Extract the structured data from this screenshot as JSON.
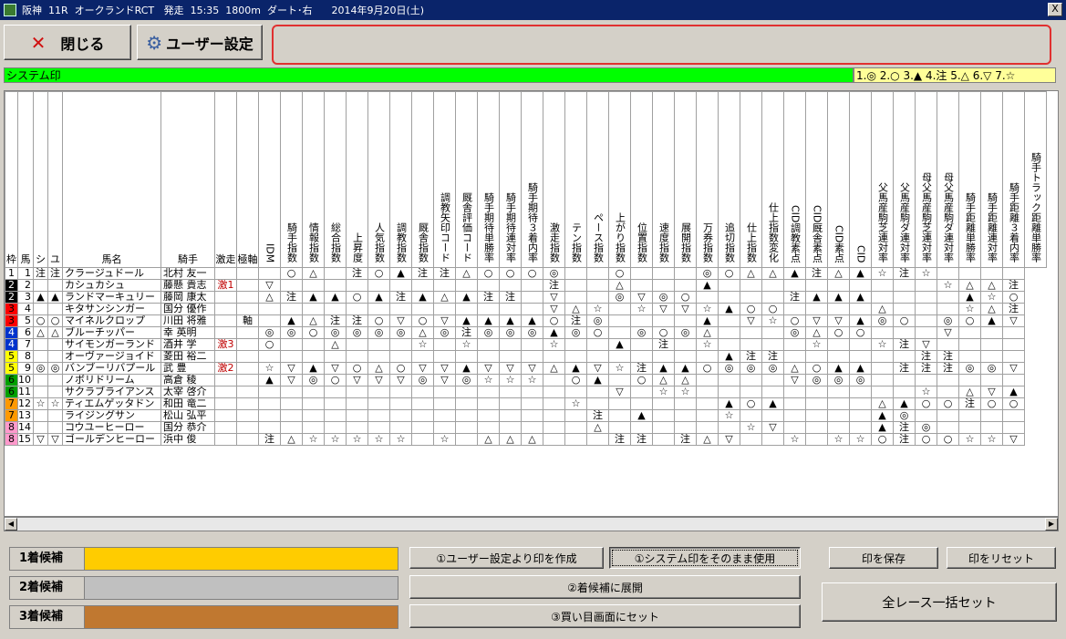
{
  "window": {
    "title": "阪神  11R  オークランドRCT   発走  15:35  1800m  ダート･右      2014年9月20日(土)",
    "close_glyph": "X"
  },
  "toolbar": {
    "close_label": "閉じる",
    "user_settings_label": "ユーザー設定"
  },
  "system_mark_bar": "システム印",
  "mark_legend": "1.◎ 2.○ 3.▲ 4.注 5.△ 6.▽ 7.☆",
  "columns": [
    {
      "label": "枠",
      "v": false
    },
    {
      "label": "馬",
      "v": false
    },
    {
      "label": "シ",
      "v": false
    },
    {
      "label": "ユ",
      "v": false
    },
    {
      "label": "馬名",
      "v": false
    },
    {
      "label": "騎手",
      "v": false
    },
    {
      "label": "激走",
      "v": false
    },
    {
      "label": "極軸",
      "v": false
    },
    {
      "label": "IDM",
      "v": true
    },
    {
      "label": "騎手指数",
      "v": true
    },
    {
      "label": "情報指数",
      "v": true
    },
    {
      "label": "総合指数",
      "v": true
    },
    {
      "label": "上昇度",
      "v": true
    },
    {
      "label": "人気指数",
      "v": true
    },
    {
      "label": "調教指数",
      "v": true
    },
    {
      "label": "厩舎指数",
      "v": true
    },
    {
      "label": "調教矢印コード",
      "v": true
    },
    {
      "label": "厩舎評価コード",
      "v": true
    },
    {
      "label": "騎手期待単勝率",
      "v": true
    },
    {
      "label": "騎手期待連対率",
      "v": true
    },
    {
      "label": "騎手期待３着内率",
      "v": true
    },
    {
      "label": "激走指数",
      "v": true
    },
    {
      "label": "テン指数",
      "v": true
    },
    {
      "label": "ペース指数",
      "v": true
    },
    {
      "label": "上がり指数",
      "v": true
    },
    {
      "label": "位置指数",
      "v": true
    },
    {
      "label": "速度指数",
      "v": true
    },
    {
      "label": "展開指数",
      "v": true
    },
    {
      "label": "万券指数",
      "v": true
    },
    {
      "label": "追切指数",
      "v": true
    },
    {
      "label": "仕上指数",
      "v": true
    },
    {
      "label": "仕上指数変化",
      "v": true
    },
    {
      "label": "CID調教素点",
      "v": true
    },
    {
      "label": "CID厩舎素点",
      "v": true
    },
    {
      "label": "CID素点",
      "v": true
    },
    {
      "label": "CID",
      "v": true
    },
    {
      "label": "父馬産駒芝連対率",
      "v": true
    },
    {
      "label": "父馬産駒ダ連対率",
      "v": true
    },
    {
      "label": "母父馬産駒芝連対率",
      "v": true
    },
    {
      "label": "母父馬産駒ダ連対率",
      "v": true
    },
    {
      "label": "騎手距離単勝率",
      "v": true
    },
    {
      "label": "騎手距離連対率",
      "v": true
    },
    {
      "label": "騎手距離３着内率",
      "v": true
    },
    {
      "label": "騎手トラック距離単勝率",
      "v": true
    }
  ],
  "waku_colors": [
    "#ffffff",
    "#000000",
    "#ff0000",
    "#0033cc",
    "#ffff00",
    "#00a000",
    "#ff9900",
    "#ff99cc"
  ],
  "rows": [
    {
      "waku": 1,
      "num": 1,
      "shi": "注",
      "yu": "注",
      "name": "クラージュドール",
      "jockey": "北村 友一",
      "gekiso": "",
      "jiku": "",
      "m": [
        "",
        "○",
        "△",
        "",
        "注",
        "○",
        "▲",
        "注",
        "注",
        "△",
        "○",
        "○",
        "○",
        "◎",
        "",
        "",
        "○",
        "",
        "",
        "",
        "◎",
        "○",
        "△",
        "△",
        "▲",
        "注",
        "△",
        "▲",
        "☆",
        "注",
        "☆",
        "",
        "",
        "",
        ""
      ]
    },
    {
      "waku": 2,
      "num": 2,
      "shi": "",
      "yu": "",
      "name": "カシュカシュ",
      "jockey": "藤懸 貴志",
      "gekiso": "激1",
      "jiku": "",
      "m": [
        "▽",
        "",
        "",
        "",
        "",
        "",
        "",
        "",
        "",
        "",
        "",
        "",
        "",
        "注",
        "",
        "",
        "△",
        "",
        "",
        "",
        "▲",
        "",
        "",
        "",
        "",
        "",
        "",
        "",
        "",
        "",
        "",
        "☆",
        "△",
        "△",
        "注"
      ]
    },
    {
      "waku": 2,
      "num": 3,
      "shi": "▲",
      "yu": "▲",
      "name": "ランドマーキュリー",
      "jockey": "藤岡 康太",
      "gekiso": "",
      "jiku": "",
      "m": [
        "△",
        "注",
        "▲",
        "▲",
        "○",
        "▲",
        "注",
        "▲",
        "△",
        "▲",
        "注",
        "注",
        "",
        "▽",
        "",
        "",
        "◎",
        "▽",
        "◎",
        "○",
        "",
        "",
        "",
        "",
        "注",
        "▲",
        "▲",
        "▲",
        "",
        "",
        "",
        "",
        "▲",
        "☆",
        "○"
      ]
    },
    {
      "waku": 3,
      "num": 4,
      "shi": "",
      "yu": "",
      "name": "キタサンシンガー",
      "jockey": "国分 優作",
      "gekiso": "",
      "jiku": "",
      "m": [
        "",
        "",
        "",
        "",
        "",
        "",
        "",
        "",
        "",
        "",
        "",
        "",
        "",
        "▽",
        "△",
        "☆",
        "",
        "☆",
        "▽",
        "▽",
        "☆",
        "▲",
        "○",
        "○",
        "",
        "",
        "",
        "",
        "△",
        "",
        "",
        "",
        "☆",
        "△",
        "注"
      ]
    },
    {
      "waku": 3,
      "num": 5,
      "shi": "○",
      "yu": "○",
      "name": "マイネルクロップ",
      "jockey": "川田 将雅",
      "gekiso": "",
      "jiku": "軸",
      "m": [
        "",
        "▲",
        "△",
        "注",
        "注",
        "○",
        "▽",
        "○",
        "▽",
        "▲",
        "▲",
        "▲",
        "▲",
        "○",
        "注",
        "◎",
        "",
        "",
        "",
        "",
        "▲",
        "",
        "▽",
        "☆",
        "○",
        "▽",
        "▽",
        "▲",
        "◎",
        "○",
        "",
        "◎",
        "○",
        "▲",
        "▽"
      ]
    },
    {
      "waku": 4,
      "num": 6,
      "shi": "△",
      "yu": "△",
      "name": "ブルーチッパー",
      "jockey": "幸 英明",
      "gekiso": "",
      "jiku": "",
      "m": [
        "◎",
        "◎",
        "○",
        "◎",
        "◎",
        "◎",
        "◎",
        "△",
        "◎",
        "注",
        "◎",
        "◎",
        "◎",
        "▲",
        "◎",
        "○",
        "",
        "◎",
        "○",
        "◎",
        "△",
        "",
        "",
        "",
        "◎",
        "△",
        "○",
        "○",
        "",
        "",
        "",
        "▽",
        "",
        "",
        ""
      ]
    },
    {
      "waku": 4,
      "num": 7,
      "shi": "",
      "yu": "",
      "name": "サイモンガーランド",
      "jockey": "酒井 学",
      "gekiso": "激3",
      "jiku": "",
      "m": [
        "○",
        "",
        "",
        "△",
        "",
        "",
        "",
        "☆",
        "",
        "☆",
        "",
        "",
        "",
        "☆",
        "",
        "",
        "▲",
        "",
        "注",
        "",
        "☆",
        "",
        "",
        "",
        "",
        "☆",
        "",
        "",
        "☆",
        "注",
        "▽",
        "",
        "",
        "",
        ""
      ]
    },
    {
      "waku": 5,
      "num": 8,
      "shi": "",
      "yu": "",
      "name": "オーヴァージョイド",
      "jockey": "菱田 裕二",
      "gekiso": "",
      "jiku": "",
      "m": [
        "",
        "",
        "",
        "",
        "",
        "",
        "",
        "",
        "",
        "",
        "",
        "",
        "",
        "",
        "",
        "",
        "",
        "",
        "",
        "",
        "",
        "▲",
        "注",
        "注",
        "",
        "",
        "",
        "",
        "",
        "",
        "注",
        "注",
        "",
        "",
        ""
      ]
    },
    {
      "waku": 5,
      "num": 9,
      "shi": "◎",
      "yu": "◎",
      "name": "バンブーリバプール",
      "jockey": "武 豊",
      "gekiso": "激2",
      "jiku": "",
      "m": [
        "☆",
        "▽",
        "▲",
        "▽",
        "○",
        "△",
        "○",
        "▽",
        "▽",
        "▲",
        "▽",
        "▽",
        "▽",
        "△",
        "▲",
        "▽",
        "☆",
        "注",
        "▲",
        "▲",
        "○",
        "◎",
        "◎",
        "◎",
        "△",
        "○",
        "▲",
        "▲",
        "",
        "注",
        "注",
        "注",
        "◎",
        "◎",
        "▽"
      ]
    },
    {
      "waku": 6,
      "num": 10,
      "shi": "",
      "yu": "",
      "name": "ノボリドリーム",
      "jockey": "高倉 稜",
      "gekiso": "",
      "jiku": "",
      "m": [
        "▲",
        "▽",
        "◎",
        "○",
        "▽",
        "▽",
        "▽",
        "◎",
        "▽",
        "◎",
        "☆",
        "☆",
        "☆",
        "",
        "○",
        "▲",
        "",
        "○",
        "△",
        "△",
        "",
        "",
        "",
        "",
        "▽",
        "◎",
        "◎",
        "◎",
        "",
        "",
        "",
        "",
        "",
        "",
        ""
      ]
    },
    {
      "waku": 6,
      "num": 11,
      "shi": "",
      "yu": "",
      "name": "サクラブライアンス",
      "jockey": "太宰 啓介",
      "gekiso": "",
      "jiku": "",
      "m": [
        "",
        "",
        "",
        "",
        "",
        "",
        "",
        "",
        "",
        "",
        "",
        "",
        "",
        "",
        "",
        "",
        "▽",
        "",
        "☆",
        "☆",
        "",
        "",
        "",
        "",
        "",
        "",
        "",
        "",
        "",
        "",
        "☆",
        "",
        "△",
        "▽",
        "▲"
      ]
    },
    {
      "waku": 7,
      "num": 12,
      "shi": "☆",
      "yu": "☆",
      "name": "ティエムゲッタドン",
      "jockey": "和田 竜二",
      "gekiso": "",
      "jiku": "",
      "m": [
        "",
        "",
        "",
        "",
        "",
        "",
        "",
        "",
        "",
        "",
        "",
        "",
        "",
        "",
        "☆",
        "",
        "",
        "",
        "",
        "",
        "",
        "▲",
        "○",
        "▲",
        "",
        "",
        "",
        "",
        "△",
        "▲",
        "○",
        "○",
        "注",
        "○",
        "○"
      ]
    },
    {
      "waku": 7,
      "num": 13,
      "shi": "",
      "yu": "",
      "name": "ライジングサン",
      "jockey": "松山 弘平",
      "gekiso": "",
      "jiku": "",
      "m": [
        "",
        "",
        "",
        "",
        "",
        "",
        "",
        "",
        "",
        "",
        "",
        "",
        "",
        "",
        "",
        "注",
        "",
        "▲",
        "",
        "",
        "",
        "☆",
        "",
        "",
        "",
        "",
        "",
        "",
        "▲",
        "◎",
        "",
        "",
        "",
        "",
        ""
      ]
    },
    {
      "waku": 8,
      "num": 14,
      "shi": "",
      "yu": "",
      "name": "コウユーヒーロー",
      "jockey": "国分 恭介",
      "gekiso": "",
      "jiku": "",
      "m": [
        "",
        "",
        "",
        "",
        "",
        "",
        "",
        "",
        "",
        "",
        "",
        "",
        "",
        "",
        "",
        "△",
        "",
        "",
        "",
        "",
        "",
        "",
        "☆",
        "▽",
        "",
        "",
        "",
        "",
        "▲",
        "注",
        "◎",
        "",
        "",
        "",
        ""
      ]
    },
    {
      "waku": 8,
      "num": 15,
      "shi": "▽",
      "yu": "▽",
      "name": "ゴールデンヒーロー",
      "jockey": "浜中 俊",
      "gekiso": "",
      "jiku": "",
      "m": [
        "注",
        "△",
        "☆",
        "☆",
        "☆",
        "☆",
        "☆",
        "",
        "☆",
        "",
        "△",
        "△",
        "△",
        "",
        "",
        "",
        "注",
        "注",
        "",
        "注",
        "△",
        "▽",
        "",
        "",
        "☆",
        "",
        "☆",
        "☆",
        "○",
        "注",
        "○",
        "○",
        "☆",
        "☆",
        "▽"
      ]
    }
  ],
  "candidates": [
    {
      "label": "1着候補",
      "color": "#ffcc00"
    },
    {
      "label": "2着候補",
      "color": "#c0c0c0"
    },
    {
      "label": "3着候補",
      "color": "#c07830"
    }
  ],
  "actions": {
    "create_from_user": "①ユーザー設定より印を作成",
    "use_system": "①システム印をそのまま使用",
    "expand": "②着候補に展開",
    "set_buy": "③買い目画面にセット",
    "save_marks": "印を保存",
    "reset_marks": "印をリセット",
    "set_all_races": "全レース一括セット"
  },
  "icons": {
    "close": "x-icon",
    "settings": "gear-icon",
    "scroll_left": "arrow-left-icon",
    "scroll_right": "arrow-right-icon"
  }
}
